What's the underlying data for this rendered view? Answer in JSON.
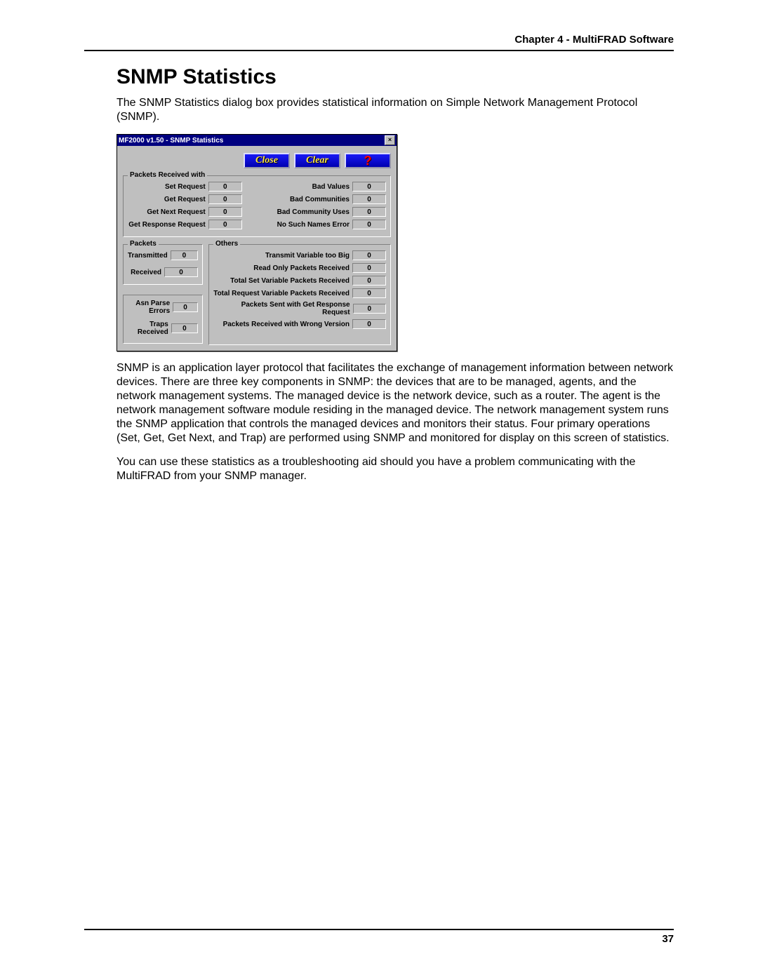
{
  "chapter_header": "Chapter 4 - MultiFRAD Software",
  "section_title": "SNMP Statistics",
  "intro_p": "The SNMP Statistics dialog box provides statistical information on Simple Network Management Protocol (SNMP).",
  "body_p1": "SNMP is an application layer protocol that facilitates the exchange of management information between network devices. There are three key components in SNMP: the devices that are to be managed, agents, and the network management systems. The managed device is the network device, such as a router. The agent is the network management software module residing in the managed device. The network management system runs the SNMP application that controls the managed devices and monitors their status. Four primary operations (Set, Get, Get Next, and Trap) are performed using SNMP and monitored for display on this screen of statistics.",
  "body_p2": "You can use these statistics as a troubleshooting aid should you have a problem communicating with the MultiFRAD from your SNMP manager.",
  "page_number": "37",
  "dialog": {
    "title": "MF2000 v1.50 - SNMP Statistics",
    "buttons": {
      "close": "Close",
      "clear": "Clear",
      "help": "?"
    },
    "groups": {
      "packets_received_with": {
        "legend": "Packets Received with",
        "left": [
          {
            "label": "Set Request",
            "value": "0"
          },
          {
            "label": "Get Request",
            "value": "0"
          },
          {
            "label": "Get Next Request",
            "value": "0"
          },
          {
            "label": "Get Response Request",
            "value": "0"
          }
        ],
        "right": [
          {
            "label": "Bad Values",
            "value": "0"
          },
          {
            "label": "Bad Communities",
            "value": "0"
          },
          {
            "label": "Bad Community Uses",
            "value": "0"
          },
          {
            "label": "No Such Names Error",
            "value": "0"
          }
        ]
      },
      "packets": {
        "legend": "Packets",
        "items": [
          {
            "label": "Transmitted",
            "value": "0"
          },
          {
            "label": "Received",
            "value": "0"
          }
        ]
      },
      "misc": {
        "items": [
          {
            "label": "Asn Parse Errors",
            "value": "0"
          },
          {
            "label": "Traps Received",
            "value": "0"
          }
        ]
      },
      "others": {
        "legend": "Others",
        "items": [
          {
            "label": "Transmit Variable too Big",
            "value": "0"
          },
          {
            "label": "Read Only Packets Received",
            "value": "0"
          },
          {
            "label": "Total Set Variable Packets Received",
            "value": "0"
          },
          {
            "label": "Total Request Variable Packets Received",
            "value": "0"
          },
          {
            "label": "Packets Sent with Get Response Request",
            "value": "0"
          },
          {
            "label": "Packets Received with Wrong Version",
            "value": "0"
          }
        ]
      }
    }
  }
}
